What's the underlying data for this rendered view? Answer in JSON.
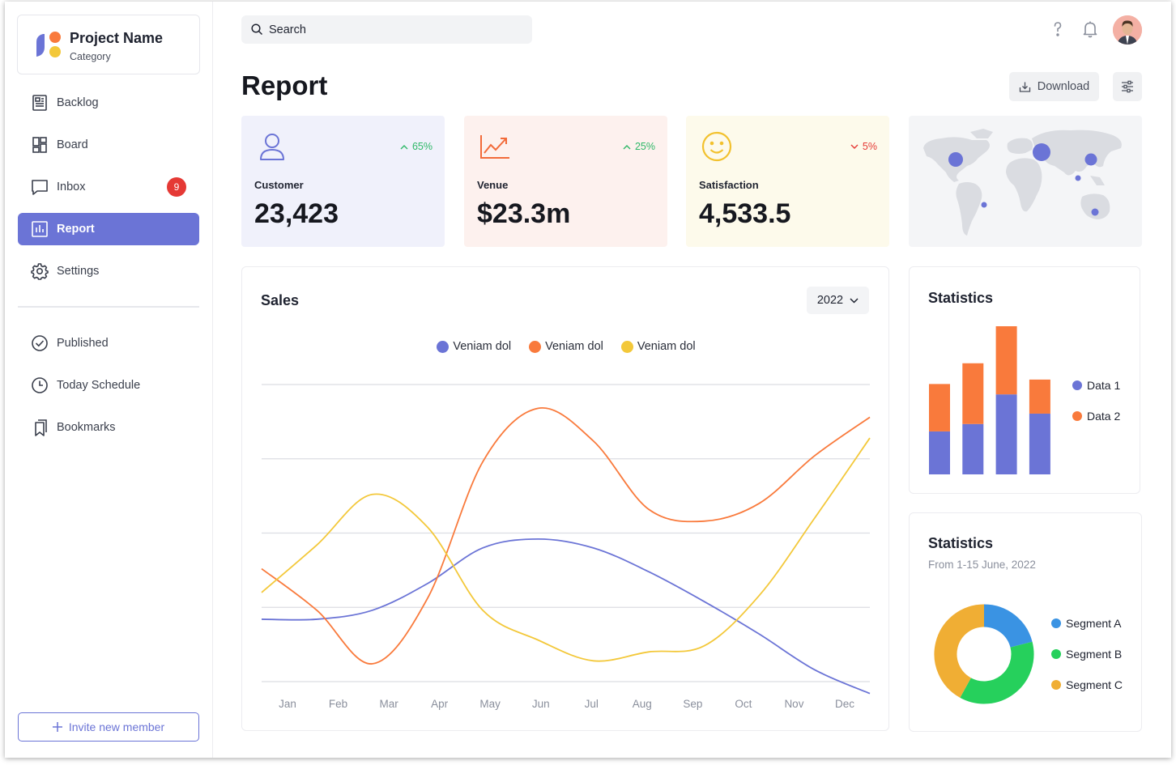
{
  "project": {
    "name": "Project Name",
    "category": "Category"
  },
  "nav": {
    "items": [
      {
        "label": "Backlog",
        "icon": "backlog-icon"
      },
      {
        "label": "Board",
        "icon": "board-icon"
      },
      {
        "label": "Inbox",
        "icon": "inbox-icon",
        "badge": "9"
      },
      {
        "label": "Report",
        "icon": "report-icon",
        "active": true
      },
      {
        "label": "Settings",
        "icon": "settings-icon"
      }
    ],
    "secondary": [
      {
        "label": "Published",
        "icon": "check-circle-icon"
      },
      {
        "label": "Today Schedule",
        "icon": "clock-icon"
      },
      {
        "label": "Bookmarks",
        "icon": "bookmark-icon"
      }
    ],
    "invite_label": "Invite new member"
  },
  "search": {
    "placeholder": "Search"
  },
  "header": {
    "title": "Report",
    "download_label": "Download"
  },
  "kpis": [
    {
      "label": "Customer",
      "value": "23,423",
      "delta": "65%",
      "direction": "up",
      "bg": "#f0f1fb",
      "accent": "#6b74d6"
    },
    {
      "label": "Venue",
      "value": "$23.3m",
      "delta": "25%",
      "direction": "up",
      "bg": "#fdf1ee",
      "accent": "#f26b3a"
    },
    {
      "label": "Satisfaction",
      "value": "4,533.5",
      "delta": "5%",
      "direction": "down",
      "bg": "#fdfaeb",
      "accent": "#f2c12e"
    }
  ],
  "colors": {
    "primary": "#6b74d6",
    "orange": "#f97a3c",
    "yellow": "#f3c83a",
    "up": "#2fb868",
    "down": "#e53935"
  },
  "sales": {
    "title": "Sales",
    "year": "2022",
    "chart_data": {
      "type": "line",
      "categories": [
        "Jan",
        "Feb",
        "Mar",
        "Apr",
        "May",
        "Jun",
        "Jul",
        "Aug",
        "Sep",
        "Oct",
        "Nov",
        "Dec"
      ],
      "ylim": [
        0,
        100
      ],
      "grid": true,
      "legend_position": "top-center",
      "series": [
        {
          "name": "Veniam dol",
          "color": "#6b74d6",
          "values": [
            21,
            21,
            24,
            33,
            45,
            48,
            45,
            37,
            27,
            16,
            4,
            -4
          ]
        },
        {
          "name": "Veniam dol",
          "color": "#f97a3c",
          "values": [
            38,
            24,
            6,
            28,
            74,
            92,
            81,
            58,
            54,
            60,
            76,
            89
          ]
        },
        {
          "name": "Veniam dol",
          "color": "#f3c83a",
          "values": [
            30,
            46,
            63,
            52,
            24,
            14,
            7,
            10,
            12,
            29,
            55,
            82
          ]
        }
      ]
    }
  },
  "stats_bar": {
    "title": "Statistics",
    "chart_data": {
      "type": "bar",
      "stacked": true,
      "categories": [
        "",
        "",
        "",
        ""
      ],
      "series": [
        {
          "name": "Data 1",
          "color": "#6b74d6",
          "values": [
            29,
            34,
            54,
            41
          ]
        },
        {
          "name": "Data 2",
          "color": "#f97a3c",
          "values": [
            32,
            41,
            46,
            23
          ]
        }
      ]
    }
  },
  "stats_donut": {
    "title": "Statistics",
    "subtitle": "From 1-15 June, 2022",
    "chart_data": {
      "type": "pie",
      "donut": true,
      "series": [
        {
          "name": "Segment A",
          "color": "#3a93e3",
          "value": 21
        },
        {
          "name": "Segment B",
          "color": "#26d05c",
          "value": 37
        },
        {
          "name": "Segment C",
          "color": "#f0ae34",
          "value": 42
        }
      ]
    }
  }
}
